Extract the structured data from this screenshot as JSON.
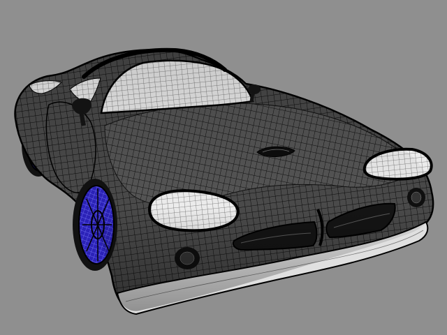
{
  "scene": {
    "subject": "car-wireframe-render",
    "colors": {
      "background": "#8f8f8f",
      "body_fill": "#4a4a4a",
      "body_fill_light": "#6b6b6b",
      "mesh_lines": "#0a0a0a",
      "glass_fill": "#e8e8e8",
      "glass_lines": "#6a6a6a",
      "wheel_fill": "#2b22b8",
      "wheel_lines": "#8080ff",
      "trim_fill": "#d9d9d9"
    },
    "icons": {
      "windshield": "windshield-shape",
      "headlights": "headlight-shape",
      "wheels": "wheel-shape"
    }
  }
}
